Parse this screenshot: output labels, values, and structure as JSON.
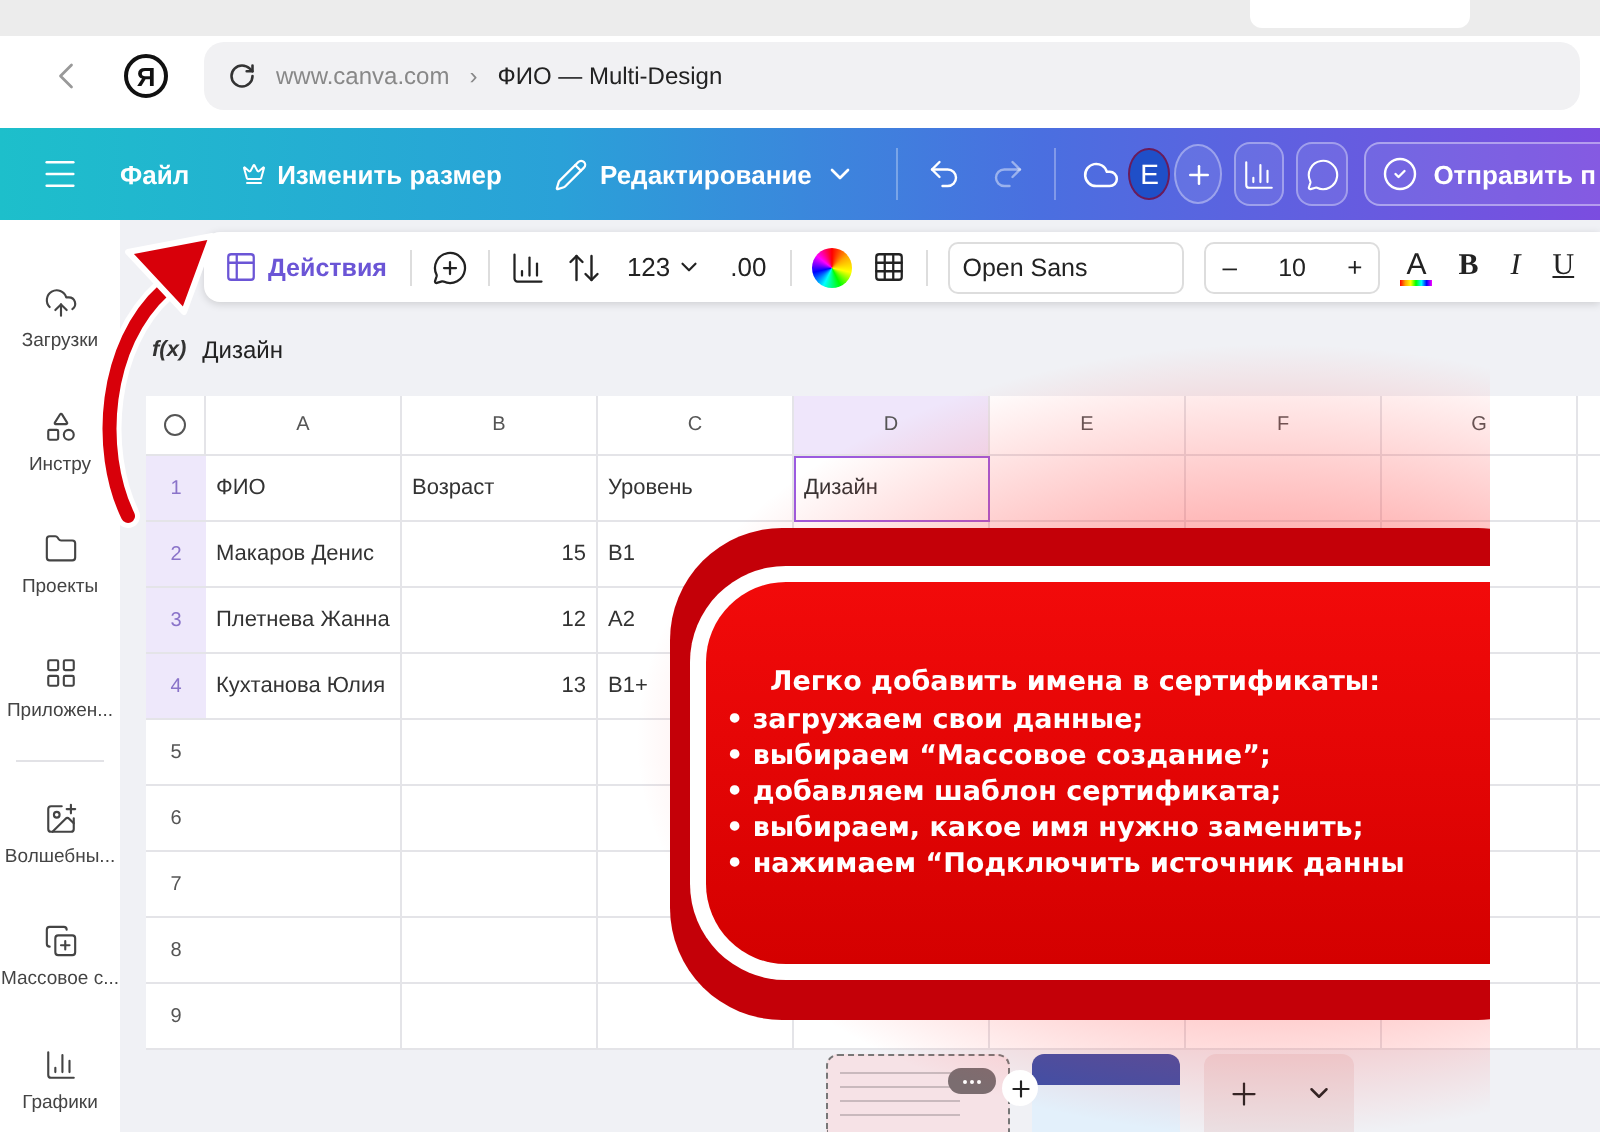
{
  "browser": {
    "logo": "Я",
    "domain": "www.canva.com",
    "separator": "›",
    "page": "ФИО — Multi-Design"
  },
  "editor_bar": {
    "file": "Файл",
    "resize": "Изменить размер",
    "edit_mode": "Редактирование",
    "avatar": "E",
    "share": "Отправить п"
  },
  "sidebar": {
    "items": [
      {
        "kind": "upload",
        "label": "Загрузки"
      },
      {
        "kind": "tools",
        "label": "Инстру"
      },
      {
        "kind": "projects",
        "label": "Проекты"
      },
      {
        "kind": "apps",
        "label": "Приложен..."
      },
      {
        "kind": "magic",
        "label": "Волшебны..."
      },
      {
        "kind": "bulk",
        "label": "Массовое с..."
      },
      {
        "kind": "charts",
        "label": "Графики"
      }
    ]
  },
  "sheet_toolbar": {
    "actions": "Действия",
    "number_format": "123",
    "decimals": ".00",
    "font": "Open Sans",
    "decrease": "–",
    "font_size": "10",
    "increase": "+",
    "text_color": "A",
    "bold": "B",
    "italic": "I",
    "underline": "U"
  },
  "formula_bar": {
    "fx": "f(x)",
    "value": "Дизайн"
  },
  "sheet": {
    "columns": [
      {
        "label": "A",
        "selected": false
      },
      {
        "label": "B",
        "selected": false
      },
      {
        "label": "C",
        "selected": false
      },
      {
        "label": "D",
        "selected": true
      },
      {
        "label": "E",
        "selected": false
      },
      {
        "label": "F",
        "selected": false
      },
      {
        "label": "G",
        "selected": false
      }
    ],
    "rows": [
      {
        "number": "1",
        "selected": true,
        "cells": [
          {
            "text": "ФИО",
            "kind": "text",
            "selected": false
          },
          {
            "text": "Возраст",
            "kind": "text",
            "selected": false
          },
          {
            "text": "Уровень",
            "kind": "text",
            "selected": false
          },
          {
            "text": "Дизайн",
            "kind": "text",
            "selected": true
          }
        ]
      },
      {
        "number": "2",
        "selected": true,
        "cells": [
          {
            "text": "Макаров Денис",
            "kind": "text",
            "selected": false
          },
          {
            "text": "15",
            "kind": "number",
            "selected": false
          },
          {
            "text": "B1",
            "kind": "text",
            "selected": false
          }
        ]
      },
      {
        "number": "3",
        "selected": true,
        "cells": [
          {
            "text": "Плетнева Жанна",
            "kind": "text",
            "selected": false
          },
          {
            "text": "12",
            "kind": "number",
            "selected": false
          },
          {
            "text": "A2",
            "kind": "text",
            "selected": false
          }
        ]
      },
      {
        "number": "4",
        "selected": true,
        "cells": [
          {
            "text": "Кухтанова Юлия",
            "kind": "text",
            "selected": false
          },
          {
            "text": "13",
            "kind": "number",
            "selected": false
          },
          {
            "text": "B1+",
            "kind": "text",
            "selected": false
          }
        ]
      },
      {
        "number": "5",
        "selected": false
      },
      {
        "number": "6",
        "selected": false
      },
      {
        "number": "7",
        "selected": false
      },
      {
        "number": "8",
        "selected": false
      },
      {
        "number": "9",
        "selected": false
      }
    ]
  },
  "callout": {
    "title": "Легко добавить имена в сертификаты:",
    "bullets": [
      "• загружаем свои данные;",
      "• выбираем “Массовое создание”;",
      "• добавляем шаблон сертификата;",
      "• выбираем, какое имя нужно заменить;",
      "• нажимаем “Подключить источник данны"
    ]
  },
  "pages": [
    {
      "kind": "sheet",
      "selected": true
    },
    {
      "kind": "certificate",
      "selected": false
    }
  ]
}
